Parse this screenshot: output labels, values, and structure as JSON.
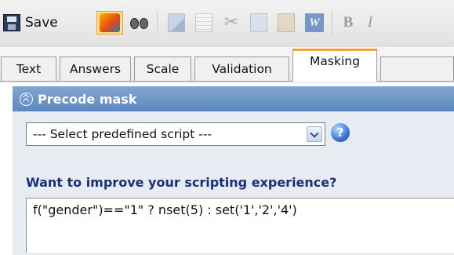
{
  "toolbar": {
    "save_label": "Save",
    "icons": [
      "save-icon",
      "script-wizard-icon",
      "binoculars-icon",
      "edit-icon",
      "document-icon",
      "scissors-icon",
      "copy-icon",
      "paste-icon",
      "word-icon",
      "bold-icon",
      "italic-icon"
    ],
    "bold_label": "B",
    "italic_label": "I",
    "scissors_glyph": "✂",
    "word_glyph": "W"
  },
  "tabs": [
    {
      "label": "Text"
    },
    {
      "label": "Answers"
    },
    {
      "label": "Scale"
    },
    {
      "label": "Validation"
    },
    {
      "label": "Masking",
      "active": true
    },
    {
      "label": ""
    }
  ],
  "panel": {
    "title": "Precode mask",
    "select_value": "--- Select predefined script ---",
    "help_glyph": "?",
    "improve_link": "Want to improve your scripting experience?",
    "script": "f(\"gender\")==\"1\" ? nset(5) : set('1','2','4')"
  },
  "colors": {
    "panel_header": "#6f97c9",
    "active_tab_accent": "#f3a12f",
    "link": "#1a2f78"
  }
}
